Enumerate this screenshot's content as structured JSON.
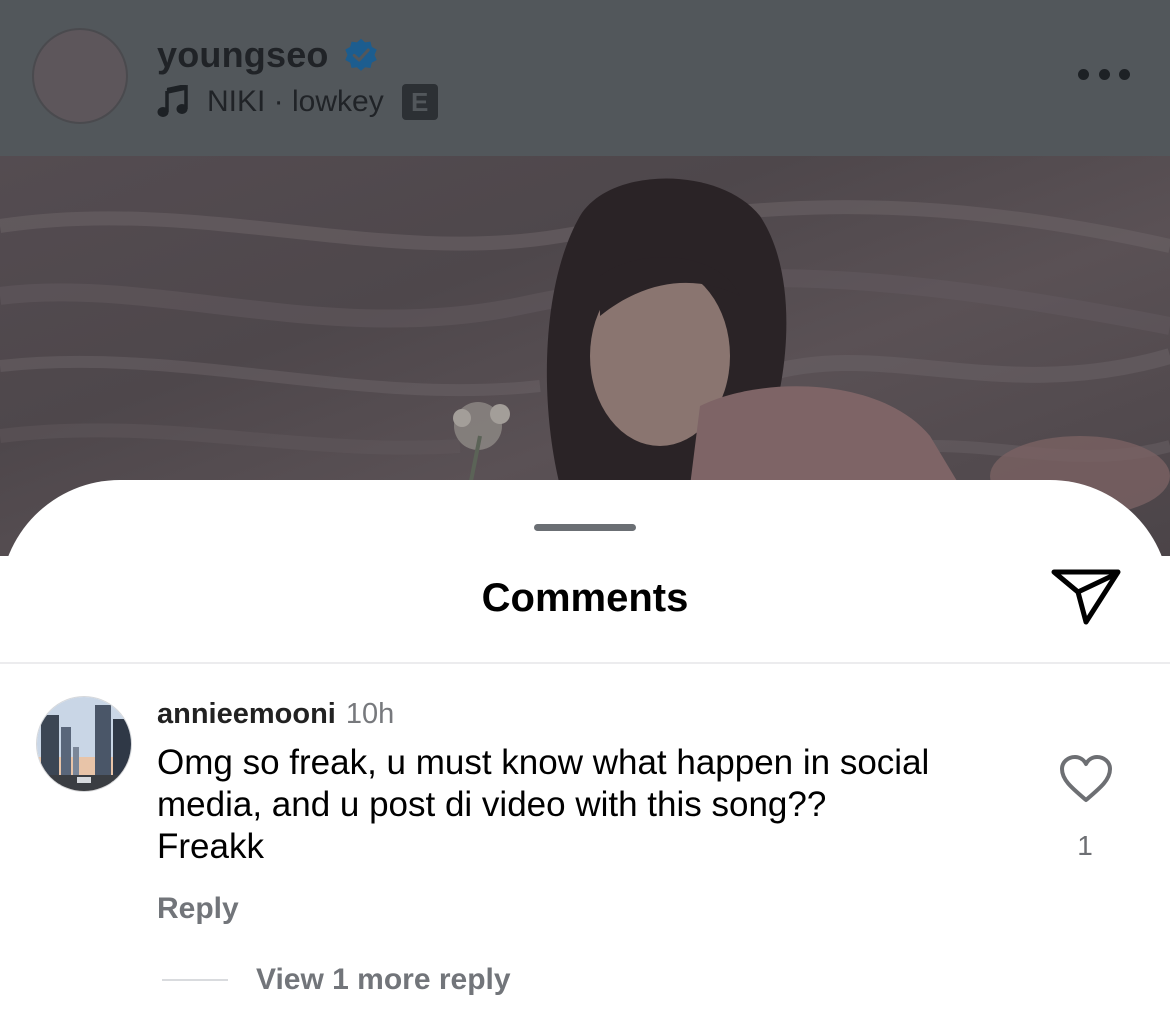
{
  "post_header": {
    "username": "youngseo",
    "verified_icon": "verified-badge-icon",
    "music_icon": "music-note-icon",
    "song": "NIKI · lowkey",
    "explicit_label": "E",
    "more_icon": "more-horizontal-icon"
  },
  "colors": {
    "overlay_dim": "#52575b",
    "verified_blue": "#1c5d8f",
    "sheet_bg": "#ffffff",
    "secondary_text": "#72757a"
  },
  "sheet": {
    "title": "Comments",
    "share_icon": "send-paper-plane-icon"
  },
  "comment": {
    "username": "annieemooni",
    "time": "10h",
    "text": "Omg so freak, u must know what happen in social\nmedia, and u post di video with this song??\nFreakk",
    "like_icon": "heart-outline-icon",
    "like_count": "1",
    "reply_label": "Reply",
    "view_replies_label": "View 1 more reply"
  }
}
